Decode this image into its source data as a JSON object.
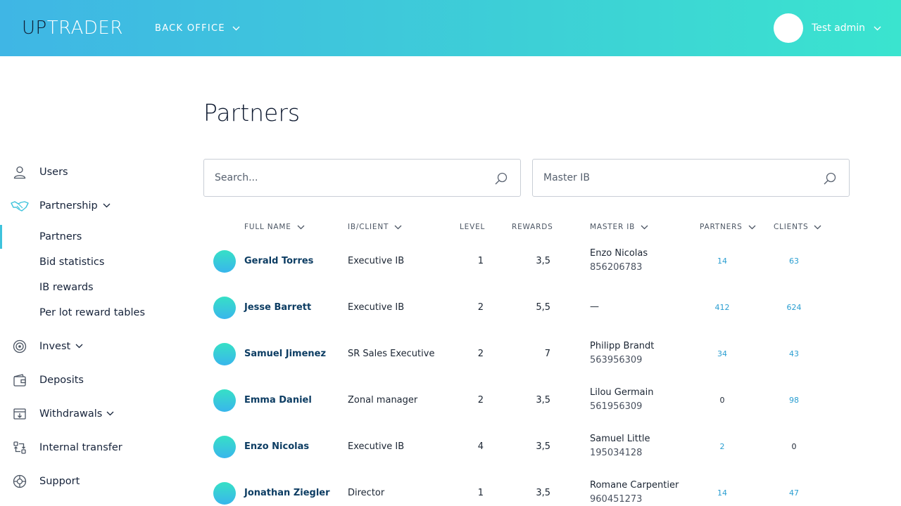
{
  "header": {
    "logo_up": "UP",
    "logo_trader": "TRADER",
    "section": "BACK OFFICE",
    "user_name": "Test admin"
  },
  "sidebar": {
    "items": [
      {
        "label": "Users",
        "icon": "user-icon"
      },
      {
        "label": "Partnership",
        "icon": "handshake-icon"
      },
      {
        "label": "Partners"
      },
      {
        "label": "Bid statistics"
      },
      {
        "label": "IB rewards"
      },
      {
        "label": "Per lot reward tables"
      },
      {
        "label": "Invest",
        "icon": "target-icon"
      },
      {
        "label": "Deposits",
        "icon": "wallet-icon"
      },
      {
        "label": "Withdrawals",
        "icon": "withdraw-icon"
      },
      {
        "label": "Internal transfer",
        "icon": "transfer-icon"
      },
      {
        "label": "Support",
        "icon": "lifebuoy-icon"
      }
    ]
  },
  "page": {
    "title": "Partners",
    "search_placeholder": "Search...",
    "master_ib_placeholder": "Master IB"
  },
  "table": {
    "columns": [
      "FULL NAME",
      "IB/CLIENT",
      "LEVEL",
      "REWARDS",
      "MASTER IB",
      "PARTNERS",
      "CLIENTS"
    ],
    "rows": [
      {
        "name": "Gerald Torres",
        "type": "Executive IB",
        "level": "1",
        "rewards": "3,5",
        "master_name": "Enzo Nicolas",
        "master_id": "856206783",
        "partners": "14",
        "clients": "63"
      },
      {
        "name": "Jesse Barrett",
        "type": "Executive IB",
        "level": "2",
        "rewards": "5,5",
        "master_name": "—",
        "master_id": "",
        "partners": "412",
        "clients": "624"
      },
      {
        "name": "Samuel Jimenez",
        "type": "SR Sales Executive",
        "level": "2",
        "rewards": "7",
        "master_name": "Philipp Brandt",
        "master_id": "563956309",
        "partners": "34",
        "clients": "43"
      },
      {
        "name": "Emma Daniel",
        "type": "Zonal manager",
        "level": "2",
        "rewards": "3,5",
        "master_name": "Lilou Germain",
        "master_id": "561956309",
        "partners": "0",
        "clients": "98"
      },
      {
        "name": "Enzo Nicolas",
        "type": "Executive IB",
        "level": "4",
        "rewards": "3,5",
        "master_name": "Samuel Little",
        "master_id": "195034128",
        "partners": "2",
        "clients": "0"
      },
      {
        "name": "Jonathan Ziegler",
        "type": "Director",
        "level": "1",
        "rewards": "3,5",
        "master_name": "Romane Carpentier",
        "master_id": "960451273",
        "partners": "14",
        "clients": "47"
      }
    ]
  },
  "colors": {
    "accent": "#3ec3dc",
    "link": "#0d3d63",
    "count_link": "#2a9ed1"
  }
}
